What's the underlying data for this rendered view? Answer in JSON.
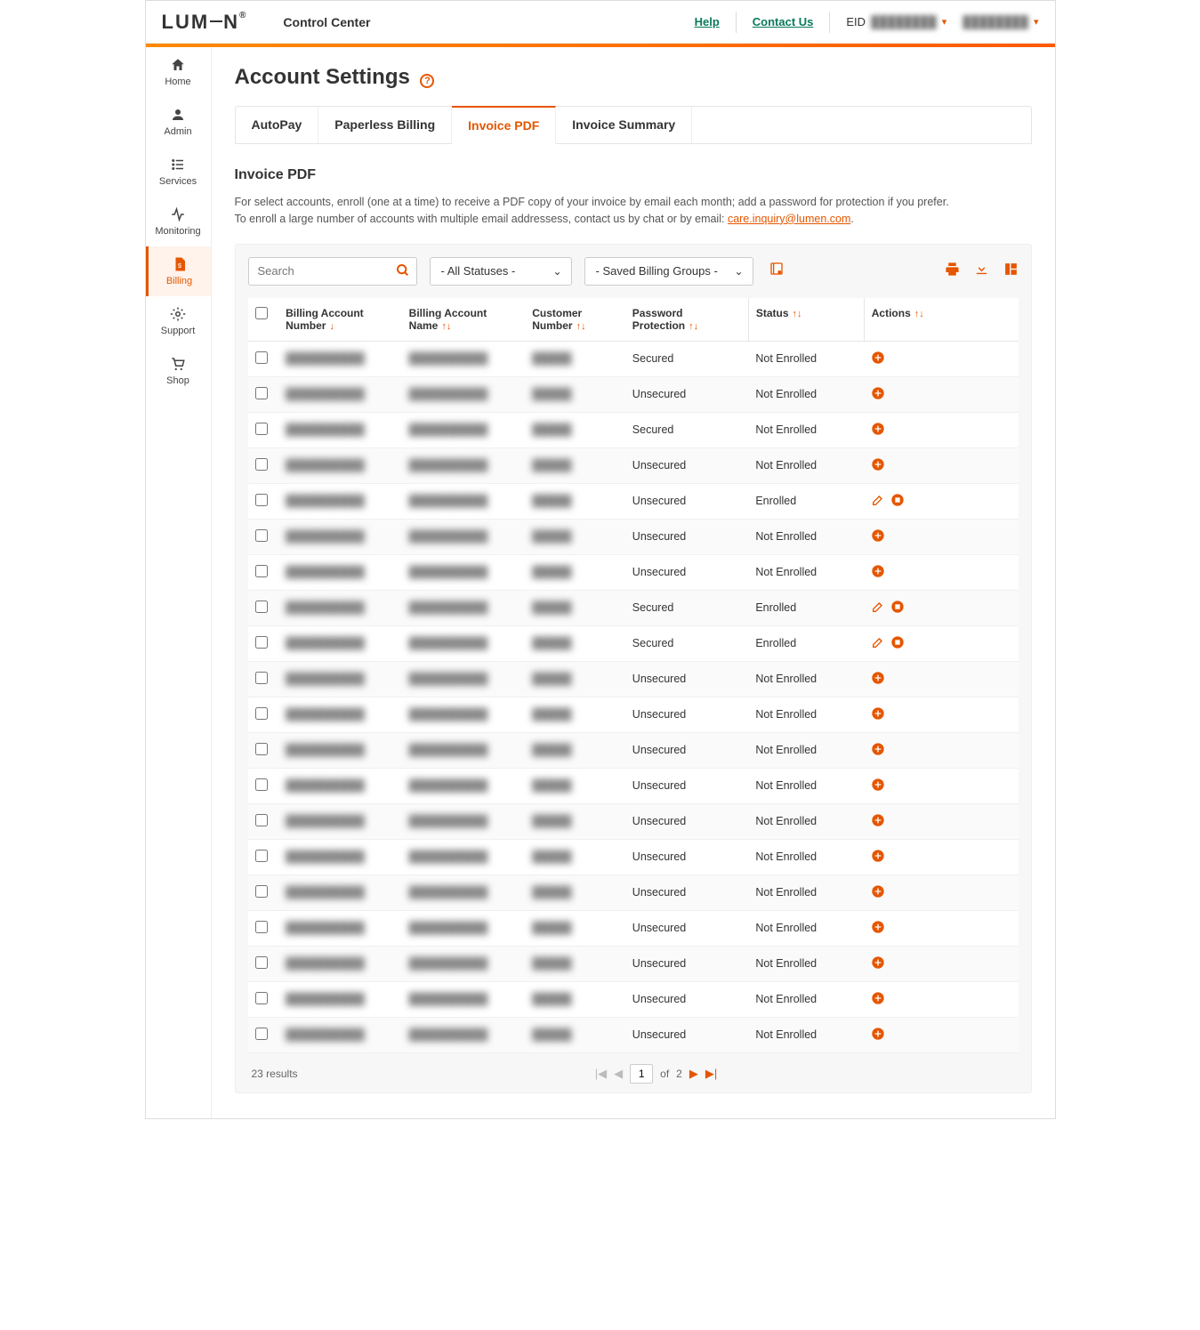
{
  "header": {
    "logo": "LUMEN",
    "app_title": "Control Center",
    "help": "Help",
    "contact": "Contact Us",
    "eid_label": "EID",
    "eid_value": "████████",
    "user": "████████"
  },
  "sidebar": [
    {
      "label": "Home",
      "icon": "home"
    },
    {
      "label": "Admin",
      "icon": "user"
    },
    {
      "label": "Services",
      "icon": "list"
    },
    {
      "label": "Monitoring",
      "icon": "activity"
    },
    {
      "label": "Billing",
      "icon": "file-dollar",
      "active": true
    },
    {
      "label": "Support",
      "icon": "gear"
    },
    {
      "label": "Shop",
      "icon": "cart"
    }
  ],
  "page": {
    "title": "Account Settings",
    "tabs": [
      "AutoPay",
      "Paperless Billing",
      "Invoice PDF",
      "Invoice Summary"
    ],
    "active_tab": 2,
    "section_title": "Invoice PDF",
    "desc1": "For select accounts, enroll (one at a time) to receive a PDF copy of your invoice by email each month; add a password for protection if you prefer.",
    "desc2_prefix": "To enroll a large number of accounts with multiple email addressess, contact us by chat or by email: ",
    "desc2_link": "care.inquiry@lumen.com",
    "desc2_suffix": "."
  },
  "toolbar": {
    "search_placeholder": "Search",
    "status_filter": "- All Statuses -",
    "group_filter": "- Saved Billing Groups -"
  },
  "columns": [
    "",
    "Billing Account Number",
    "Billing Account Name",
    "Customer Number",
    "Password Protection",
    "Status",
    "Actions"
  ],
  "rows": [
    {
      "ban": "██████████",
      "name": "██████████",
      "cust": "█████",
      "pw": "Secured",
      "status": "Not Enrolled",
      "action": "add"
    },
    {
      "ban": "██████████",
      "name": "██████████",
      "cust": "█████",
      "pw": "Unsecured",
      "status": "Not Enrolled",
      "action": "add"
    },
    {
      "ban": "██████████",
      "name": "██████████",
      "cust": "█████",
      "pw": "Secured",
      "status": "Not Enrolled",
      "action": "add"
    },
    {
      "ban": "██████████",
      "name": "██████████",
      "cust": "█████",
      "pw": "Unsecured",
      "status": "Not Enrolled",
      "action": "add"
    },
    {
      "ban": "██████████",
      "name": "██████████",
      "cust": "█████",
      "pw": "Unsecured",
      "status": "Enrolled",
      "action": "edit"
    },
    {
      "ban": "██████████",
      "name": "██████████",
      "cust": "█████",
      "pw": "Unsecured",
      "status": "Not Enrolled",
      "action": "add"
    },
    {
      "ban": "██████████",
      "name": "██████████",
      "cust": "█████",
      "pw": "Unsecured",
      "status": "Not Enrolled",
      "action": "add"
    },
    {
      "ban": "██████████",
      "name": "██████████",
      "cust": "█████",
      "pw": "Secured",
      "status": "Enrolled",
      "action": "edit"
    },
    {
      "ban": "██████████",
      "name": "██████████",
      "cust": "█████",
      "pw": "Secured",
      "status": "Enrolled",
      "action": "edit"
    },
    {
      "ban": "██████████",
      "name": "██████████",
      "cust": "█████",
      "pw": "Unsecured",
      "status": "Not Enrolled",
      "action": "add"
    },
    {
      "ban": "██████████",
      "name": "██████████",
      "cust": "█████",
      "pw": "Unsecured",
      "status": "Not Enrolled",
      "action": "add"
    },
    {
      "ban": "██████████",
      "name": "██████████",
      "cust": "█████",
      "pw": "Unsecured",
      "status": "Not Enrolled",
      "action": "add"
    },
    {
      "ban": "██████████",
      "name": "██████████",
      "cust": "█████",
      "pw": "Unsecured",
      "status": "Not Enrolled",
      "action": "add"
    },
    {
      "ban": "██████████",
      "name": "██████████",
      "cust": "█████",
      "pw": "Unsecured",
      "status": "Not Enrolled",
      "action": "add"
    },
    {
      "ban": "██████████",
      "name": "██████████",
      "cust": "█████",
      "pw": "Unsecured",
      "status": "Not Enrolled",
      "action": "add"
    },
    {
      "ban": "██████████",
      "name": "██████████",
      "cust": "█████",
      "pw": "Unsecured",
      "status": "Not Enrolled",
      "action": "add"
    },
    {
      "ban": "██████████",
      "name": "██████████",
      "cust": "█████",
      "pw": "Unsecured",
      "status": "Not Enrolled",
      "action": "add"
    },
    {
      "ban": "██████████",
      "name": "██████████",
      "cust": "█████",
      "pw": "Unsecured",
      "status": "Not Enrolled",
      "action": "add"
    },
    {
      "ban": "██████████",
      "name": "██████████",
      "cust": "█████",
      "pw": "Unsecured",
      "status": "Not Enrolled",
      "action": "add"
    },
    {
      "ban": "██████████",
      "name": "██████████",
      "cust": "█████",
      "pw": "Unsecured",
      "status": "Not Enrolled",
      "action": "add"
    }
  ],
  "footer": {
    "results": "23 results",
    "page_current": "1",
    "page_of": "of",
    "page_total": "2"
  }
}
